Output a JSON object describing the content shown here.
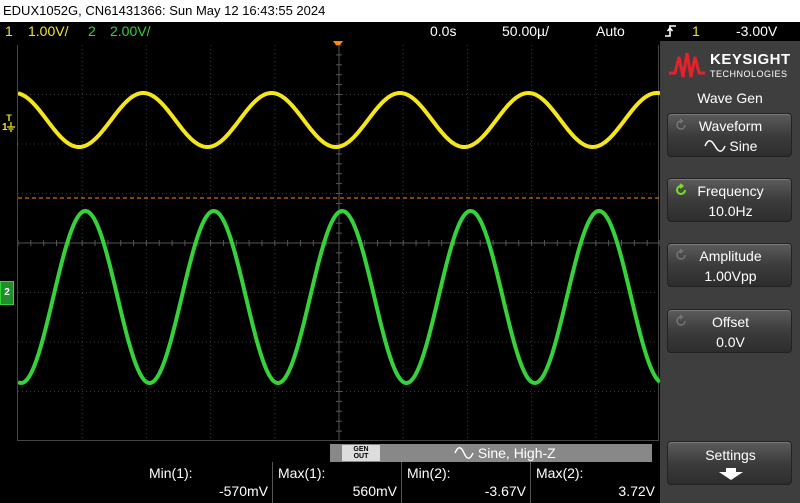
{
  "titlebar": {
    "text": "EDUX1052G, CN61431366: Sun May 12 16:43:55 2024"
  },
  "status": {
    "ch1_num": "1",
    "ch1_scale": "1.00V/",
    "ch2_num": "2",
    "ch2_scale": "2.00V/",
    "time_delay": "0.0s",
    "time_scale": "50.00µ/",
    "trigger_mode": "Auto",
    "trigger_source_num": "1",
    "trigger_level": "-3.00V",
    "trigger_icon": "rising-edge-icon"
  },
  "markers": {
    "ch1": "1",
    "ch1_trigger": "T",
    "ch2": "2"
  },
  "colors": {
    "ch1": "#f5e61c",
    "ch2": "#35d23a",
    "trigger": "#ff8a00",
    "grid": "#3a3a3a"
  },
  "waveforms": {
    "ch1": {
      "shape": "sine",
      "cycles_on_screen": 5,
      "min_v": -0.57,
      "max_v": 0.56
    },
    "ch2": {
      "shape": "sine",
      "cycles_on_screen": 5,
      "min_v": -3.67,
      "max_v": 3.72
    }
  },
  "gen_bar": {
    "out_line1": "GEN",
    "out_line2": "OUT",
    "status": "Sine, High-Z",
    "icon": "sine-wave-icon"
  },
  "measurements": [
    {
      "label": "Min(1):",
      "value": "-570mV"
    },
    {
      "label": "Max(1):",
      "value": "560mV"
    },
    {
      "label": "Min(2):",
      "value": "-3.67V"
    },
    {
      "label": "Max(2):",
      "value": "3.72V"
    }
  ],
  "panel": {
    "brand": "KEYSIGHT",
    "brand_sub": "TECHNOLOGIES",
    "title": "Wave Gen",
    "keys": [
      {
        "title": "Waveform",
        "value": "Sine",
        "icon": "rotate-icon",
        "value_icon": "sine-wave-icon"
      },
      {
        "title": "Frequency",
        "value": "10.0Hz",
        "icon": "rotate-active-icon"
      },
      {
        "title": "Amplitude",
        "value": "1.00Vpp",
        "icon": "rotate-icon"
      },
      {
        "title": "Offset",
        "value": "0.0V",
        "icon": "rotate-icon"
      }
    ],
    "settings": {
      "title": "Settings",
      "icon": "arrow-down-icon"
    }
  }
}
